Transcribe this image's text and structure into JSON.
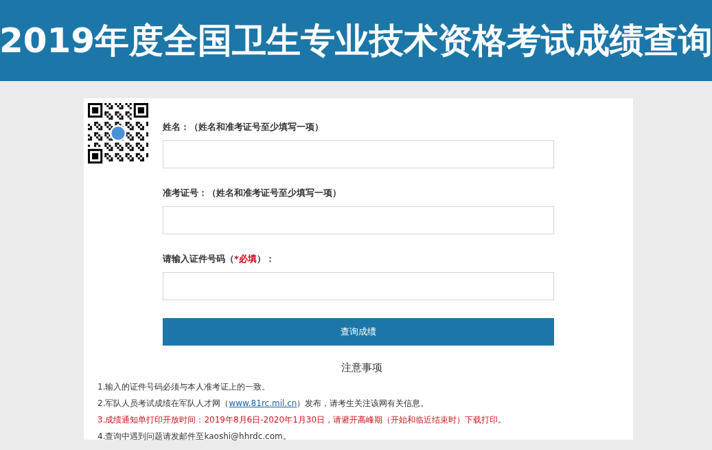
{
  "header": {
    "title": "2019年度全国卫生专业技术资格考试成绩查询"
  },
  "form": {
    "fields": [
      {
        "kind": "plain",
        "label": "姓名：（姓名和准考证号至少填写一项）"
      },
      {
        "kind": "plain",
        "label": "准考证号：（姓名和准考证号至少填写一项）"
      },
      {
        "kind": "required",
        "label_before": "请输入证件号码（",
        "required": "*必填",
        "label_after": "）："
      }
    ],
    "submit": "查询成绩"
  },
  "notes": {
    "title": "注意事项",
    "items": [
      {
        "kind": "plain",
        "text": "1.输入的证件号码必须与本人准考证上的一致。"
      },
      {
        "kind": "link",
        "before": "2.军队人员考试成绩在军队人才网（",
        "link": "www.81rc.mil.cn",
        "after": "）发布，请考生关注该网有关信息。"
      },
      {
        "kind": "warning",
        "text": "3.成绩通知单打印开放时间：2019年8月6日-2020年1月30日，请避开高峰期（开始和临近结束时）下载打印。"
      },
      {
        "kind": "plain",
        "text": "4.查询中遇到问题请发邮件至kaoshi@hhrdc.com。"
      }
    ]
  }
}
